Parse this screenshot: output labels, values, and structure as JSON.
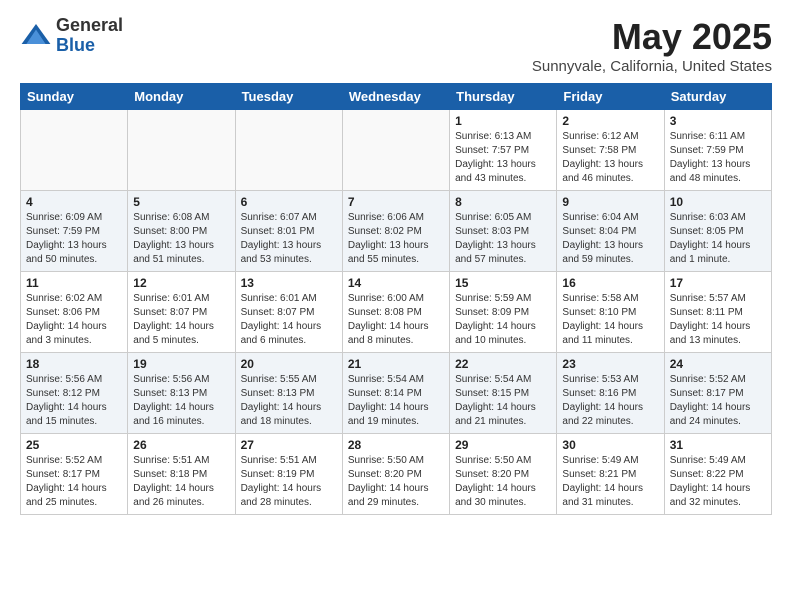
{
  "logo": {
    "general": "General",
    "blue": "Blue"
  },
  "header": {
    "title": "May 2025",
    "subtitle": "Sunnyvale, California, United States"
  },
  "days_of_week": [
    "Sunday",
    "Monday",
    "Tuesday",
    "Wednesday",
    "Thursday",
    "Friday",
    "Saturday"
  ],
  "weeks": [
    [
      {
        "day": "",
        "info": ""
      },
      {
        "day": "",
        "info": ""
      },
      {
        "day": "",
        "info": ""
      },
      {
        "day": "",
        "info": ""
      },
      {
        "day": "1",
        "info": "Sunrise: 6:13 AM\nSunset: 7:57 PM\nDaylight: 13 hours\nand 43 minutes."
      },
      {
        "day": "2",
        "info": "Sunrise: 6:12 AM\nSunset: 7:58 PM\nDaylight: 13 hours\nand 46 minutes."
      },
      {
        "day": "3",
        "info": "Sunrise: 6:11 AM\nSunset: 7:59 PM\nDaylight: 13 hours\nand 48 minutes."
      }
    ],
    [
      {
        "day": "4",
        "info": "Sunrise: 6:09 AM\nSunset: 7:59 PM\nDaylight: 13 hours\nand 50 minutes."
      },
      {
        "day": "5",
        "info": "Sunrise: 6:08 AM\nSunset: 8:00 PM\nDaylight: 13 hours\nand 51 minutes."
      },
      {
        "day": "6",
        "info": "Sunrise: 6:07 AM\nSunset: 8:01 PM\nDaylight: 13 hours\nand 53 minutes."
      },
      {
        "day": "7",
        "info": "Sunrise: 6:06 AM\nSunset: 8:02 PM\nDaylight: 13 hours\nand 55 minutes."
      },
      {
        "day": "8",
        "info": "Sunrise: 6:05 AM\nSunset: 8:03 PM\nDaylight: 13 hours\nand 57 minutes."
      },
      {
        "day": "9",
        "info": "Sunrise: 6:04 AM\nSunset: 8:04 PM\nDaylight: 13 hours\nand 59 minutes."
      },
      {
        "day": "10",
        "info": "Sunrise: 6:03 AM\nSunset: 8:05 PM\nDaylight: 14 hours\nand 1 minute."
      }
    ],
    [
      {
        "day": "11",
        "info": "Sunrise: 6:02 AM\nSunset: 8:06 PM\nDaylight: 14 hours\nand 3 minutes."
      },
      {
        "day": "12",
        "info": "Sunrise: 6:01 AM\nSunset: 8:07 PM\nDaylight: 14 hours\nand 5 minutes."
      },
      {
        "day": "13",
        "info": "Sunrise: 6:01 AM\nSunset: 8:07 PM\nDaylight: 14 hours\nand 6 minutes."
      },
      {
        "day": "14",
        "info": "Sunrise: 6:00 AM\nSunset: 8:08 PM\nDaylight: 14 hours\nand 8 minutes."
      },
      {
        "day": "15",
        "info": "Sunrise: 5:59 AM\nSunset: 8:09 PM\nDaylight: 14 hours\nand 10 minutes."
      },
      {
        "day": "16",
        "info": "Sunrise: 5:58 AM\nSunset: 8:10 PM\nDaylight: 14 hours\nand 11 minutes."
      },
      {
        "day": "17",
        "info": "Sunrise: 5:57 AM\nSunset: 8:11 PM\nDaylight: 14 hours\nand 13 minutes."
      }
    ],
    [
      {
        "day": "18",
        "info": "Sunrise: 5:56 AM\nSunset: 8:12 PM\nDaylight: 14 hours\nand 15 minutes."
      },
      {
        "day": "19",
        "info": "Sunrise: 5:56 AM\nSunset: 8:13 PM\nDaylight: 14 hours\nand 16 minutes."
      },
      {
        "day": "20",
        "info": "Sunrise: 5:55 AM\nSunset: 8:13 PM\nDaylight: 14 hours\nand 18 minutes."
      },
      {
        "day": "21",
        "info": "Sunrise: 5:54 AM\nSunset: 8:14 PM\nDaylight: 14 hours\nand 19 minutes."
      },
      {
        "day": "22",
        "info": "Sunrise: 5:54 AM\nSunset: 8:15 PM\nDaylight: 14 hours\nand 21 minutes."
      },
      {
        "day": "23",
        "info": "Sunrise: 5:53 AM\nSunset: 8:16 PM\nDaylight: 14 hours\nand 22 minutes."
      },
      {
        "day": "24",
        "info": "Sunrise: 5:52 AM\nSunset: 8:17 PM\nDaylight: 14 hours\nand 24 minutes."
      }
    ],
    [
      {
        "day": "25",
        "info": "Sunrise: 5:52 AM\nSunset: 8:17 PM\nDaylight: 14 hours\nand 25 minutes."
      },
      {
        "day": "26",
        "info": "Sunrise: 5:51 AM\nSunset: 8:18 PM\nDaylight: 14 hours\nand 26 minutes."
      },
      {
        "day": "27",
        "info": "Sunrise: 5:51 AM\nSunset: 8:19 PM\nDaylight: 14 hours\nand 28 minutes."
      },
      {
        "day": "28",
        "info": "Sunrise: 5:50 AM\nSunset: 8:20 PM\nDaylight: 14 hours\nand 29 minutes."
      },
      {
        "day": "29",
        "info": "Sunrise: 5:50 AM\nSunset: 8:20 PM\nDaylight: 14 hours\nand 30 minutes."
      },
      {
        "day": "30",
        "info": "Sunrise: 5:49 AM\nSunset: 8:21 PM\nDaylight: 14 hours\nand 31 minutes."
      },
      {
        "day": "31",
        "info": "Sunrise: 5:49 AM\nSunset: 8:22 PM\nDaylight: 14 hours\nand 32 minutes."
      }
    ]
  ]
}
